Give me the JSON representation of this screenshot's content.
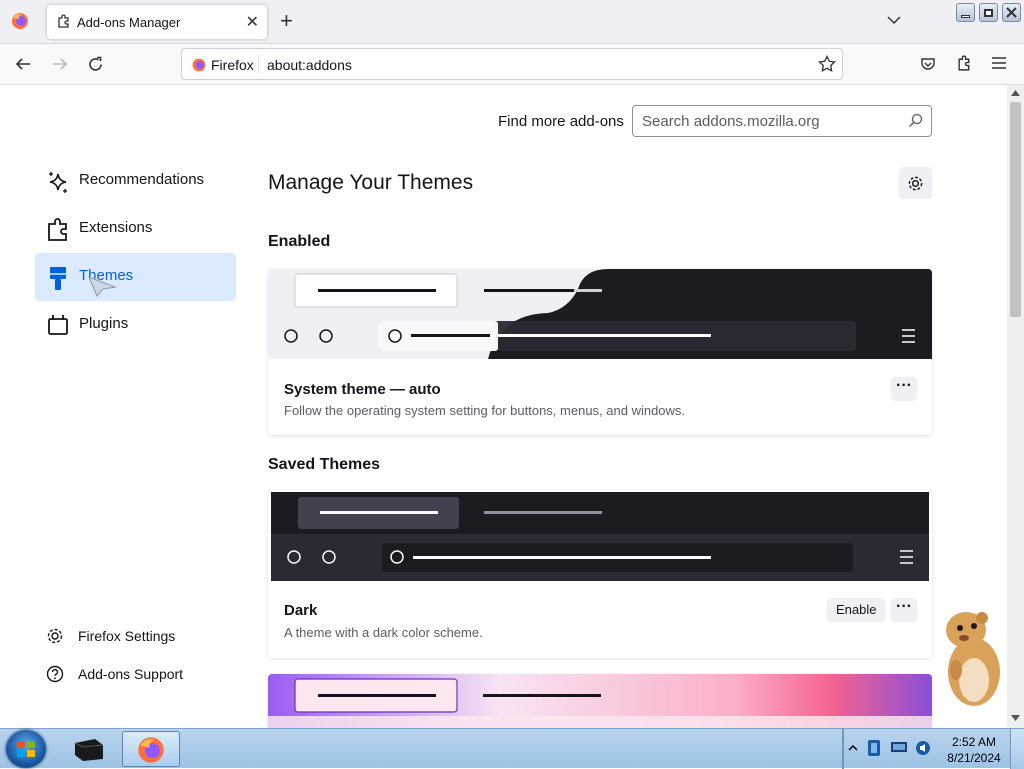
{
  "browser": {
    "tab_title": "Add-ons Manager",
    "tab_close": "✕",
    "new_tab": "+",
    "identity_label": "Firefox",
    "url": "about:addons"
  },
  "header": {
    "find_more_label": "Find more add-ons",
    "search_placeholder": "Search addons.mozilla.org"
  },
  "sidebar": {
    "items": [
      {
        "label": "Recommendations",
        "icon": "sparkle-icon"
      },
      {
        "label": "Extensions",
        "icon": "puzzle-icon"
      },
      {
        "label": "Themes",
        "icon": "brush-icon",
        "selected": true
      },
      {
        "label": "Plugins",
        "icon": "plugin-icon"
      }
    ],
    "footer": [
      {
        "label": "Firefox Settings",
        "icon": "gear-icon"
      },
      {
        "label": "Add-ons Support",
        "icon": "help-icon"
      }
    ]
  },
  "main": {
    "title": "Manage Your Themes",
    "enabled_heading": "Enabled",
    "saved_heading": "Saved Themes",
    "enabled_theme": {
      "name": "System theme — auto",
      "description": "Follow the operating system setting for buttons, menus, and windows.",
      "more": "···"
    },
    "saved_themes": [
      {
        "name": "Dark",
        "description": "A theme with a dark color scheme.",
        "enable_label": "Enable",
        "more": "···"
      }
    ]
  },
  "taskbar": {
    "time": "2:52 AM",
    "date": "8/21/2024"
  },
  "colors": {
    "accent": "#0061e0",
    "selected_bg": "#dbeafe",
    "dark_theme": "#1c1b22"
  }
}
